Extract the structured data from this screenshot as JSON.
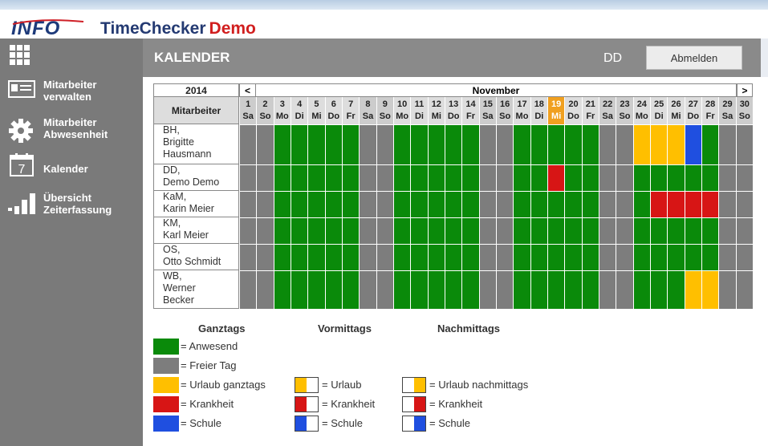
{
  "app": {
    "name_part1": "TimeChecker",
    "name_part2": "Demo",
    "logo_text": "INFO"
  },
  "sidebar": {
    "items": [
      {
        "label": "Mitarbeiter verwalten",
        "icon": "id-card-icon"
      },
      {
        "label": "Mitarbeiter Abwesenheit",
        "icon": "gear-icon"
      },
      {
        "label": "Kalender",
        "icon": "calendar-icon",
        "icon_text": "7"
      },
      {
        "label": "Übersicht Zeiterfassung",
        "icon": "bar-chart-icon"
      }
    ]
  },
  "topbar": {
    "title": "KALENDER",
    "user": "DD",
    "logout_label": "Abmelden"
  },
  "calendar": {
    "year": "2014",
    "month": "November",
    "prev_label": "<",
    "next_label": ">",
    "employee_header": "Mitarbeiter",
    "highlight_day": 19,
    "days": [
      {
        "d": "1",
        "w": "Sa"
      },
      {
        "d": "2",
        "w": "So"
      },
      {
        "d": "3",
        "w": "Mo"
      },
      {
        "d": "4",
        "w": "Di"
      },
      {
        "d": "5",
        "w": "Mi"
      },
      {
        "d": "6",
        "w": "Do"
      },
      {
        "d": "7",
        "w": "Fr"
      },
      {
        "d": "8",
        "w": "Sa"
      },
      {
        "d": "9",
        "w": "So"
      },
      {
        "d": "10",
        "w": "Mo"
      },
      {
        "d": "11",
        "w": "Di"
      },
      {
        "d": "12",
        "w": "Mi"
      },
      {
        "d": "13",
        "w": "Do"
      },
      {
        "d": "14",
        "w": "Fr"
      },
      {
        "d": "15",
        "w": "Sa"
      },
      {
        "d": "16",
        "w": "So"
      },
      {
        "d": "17",
        "w": "Mo"
      },
      {
        "d": "18",
        "w": "Di"
      },
      {
        "d": "19",
        "w": "Mi"
      },
      {
        "d": "20",
        "w": "Do"
      },
      {
        "d": "21",
        "w": "Fr"
      },
      {
        "d": "22",
        "w": "Sa"
      },
      {
        "d": "23",
        "w": "So"
      },
      {
        "d": "24",
        "w": "Mo"
      },
      {
        "d": "25",
        "w": "Di"
      },
      {
        "d": "26",
        "w": "Mi"
      },
      {
        "d": "27",
        "w": "Do"
      },
      {
        "d": "28",
        "w": "Fr"
      },
      {
        "d": "29",
        "w": "Sa"
      },
      {
        "d": "30",
        "w": "So"
      }
    ],
    "employees": [
      {
        "name_lines": [
          "BH,",
          "Brigitte",
          "Hausmann"
        ],
        "days": [
          "F",
          "F",
          "A",
          "A",
          "A",
          "A",
          "A",
          "F",
          "F",
          "A",
          "A",
          "A",
          "A",
          "A",
          "F",
          "F",
          "A",
          "A",
          "A",
          "A",
          "A",
          "F",
          "F",
          "U",
          "U",
          "U",
          "S",
          "A",
          "F",
          "F"
        ]
      },
      {
        "name_lines": [
          "DD,",
          "Demo Demo"
        ],
        "days": [
          "F",
          "F",
          "A",
          "A",
          "A",
          "A",
          "A",
          "F",
          "F",
          "A",
          "A",
          "A",
          "A",
          "A",
          "F",
          "F",
          "A",
          "A",
          "K",
          "A",
          "A",
          "F",
          "F",
          "A",
          "A",
          "A",
          "A",
          "A",
          "F",
          "F"
        ]
      },
      {
        "name_lines": [
          "KaM,",
          "Karin Meier"
        ],
        "days": [
          "F",
          "F",
          "A",
          "A",
          "A",
          "A",
          "A",
          "F",
          "F",
          "A",
          "A",
          "A",
          "A",
          "A",
          "F",
          "F",
          "A",
          "A",
          "A",
          "A",
          "A",
          "F",
          "F",
          "A",
          "K",
          "K",
          "K",
          "K",
          "F",
          "F"
        ]
      },
      {
        "name_lines": [
          "KM,",
          "Karl Meier"
        ],
        "days": [
          "F",
          "F",
          "A",
          "A",
          "A",
          "A",
          "A",
          "F",
          "F",
          "A",
          "A",
          "A",
          "A",
          "A",
          "F",
          "F",
          "A",
          "A",
          "A",
          "A",
          "A",
          "F",
          "F",
          "A",
          "A",
          "A",
          "A",
          "A",
          "F",
          "F"
        ]
      },
      {
        "name_lines": [
          "OS,",
          "Otto Schmidt"
        ],
        "days": [
          "F",
          "F",
          "A",
          "A",
          "A",
          "A",
          "A",
          "F",
          "F",
          "A",
          "A",
          "A",
          "A",
          "A",
          "F",
          "F",
          "A",
          "A",
          "A",
          "A",
          "A",
          "F",
          "F",
          "A",
          "A",
          "A",
          "A",
          "A",
          "F",
          "F"
        ]
      },
      {
        "name_lines": [
          "WB,",
          "Werner",
          "Becker"
        ],
        "days": [
          "F",
          "F",
          "A",
          "A",
          "A",
          "A",
          "A",
          "F",
          "F",
          "A",
          "A",
          "A",
          "A",
          "A",
          "F",
          "F",
          "A",
          "A",
          "A",
          "A",
          "A",
          "F",
          "F",
          "A",
          "A",
          "A",
          "U",
          "U",
          "F",
          "F"
        ]
      }
    ]
  },
  "status_colors": {
    "A": "#0a8a0a",
    "F": "#7d7d7d",
    "U": "#ffbf00",
    "K": "#d71515",
    "S": "#1f4fe0"
  },
  "legend": {
    "col_ganztags": "Ganztags",
    "col_vormittags": "Vormittags",
    "col_nachmittags": "Nachmittags",
    "ganztags": [
      {
        "label": "= Anwesend",
        "status": "A"
      },
      {
        "label": "= Freier Tag",
        "status": "F"
      },
      {
        "label": "= Urlaub ganztags",
        "status": "U"
      },
      {
        "label": "= Krankheit",
        "status": "K"
      },
      {
        "label": "= Schule",
        "status": "S"
      }
    ],
    "vormittags": [
      {
        "label": "= Urlaub",
        "status": "U"
      },
      {
        "label": "= Krankheit",
        "status": "K"
      },
      {
        "label": "= Schule",
        "status": "S"
      }
    ],
    "nachmittags": [
      {
        "label": "= Urlaub nachmittags",
        "status": "U"
      },
      {
        "label": "= Krankheit",
        "status": "K"
      },
      {
        "label": "= Schule",
        "status": "S"
      }
    ]
  }
}
